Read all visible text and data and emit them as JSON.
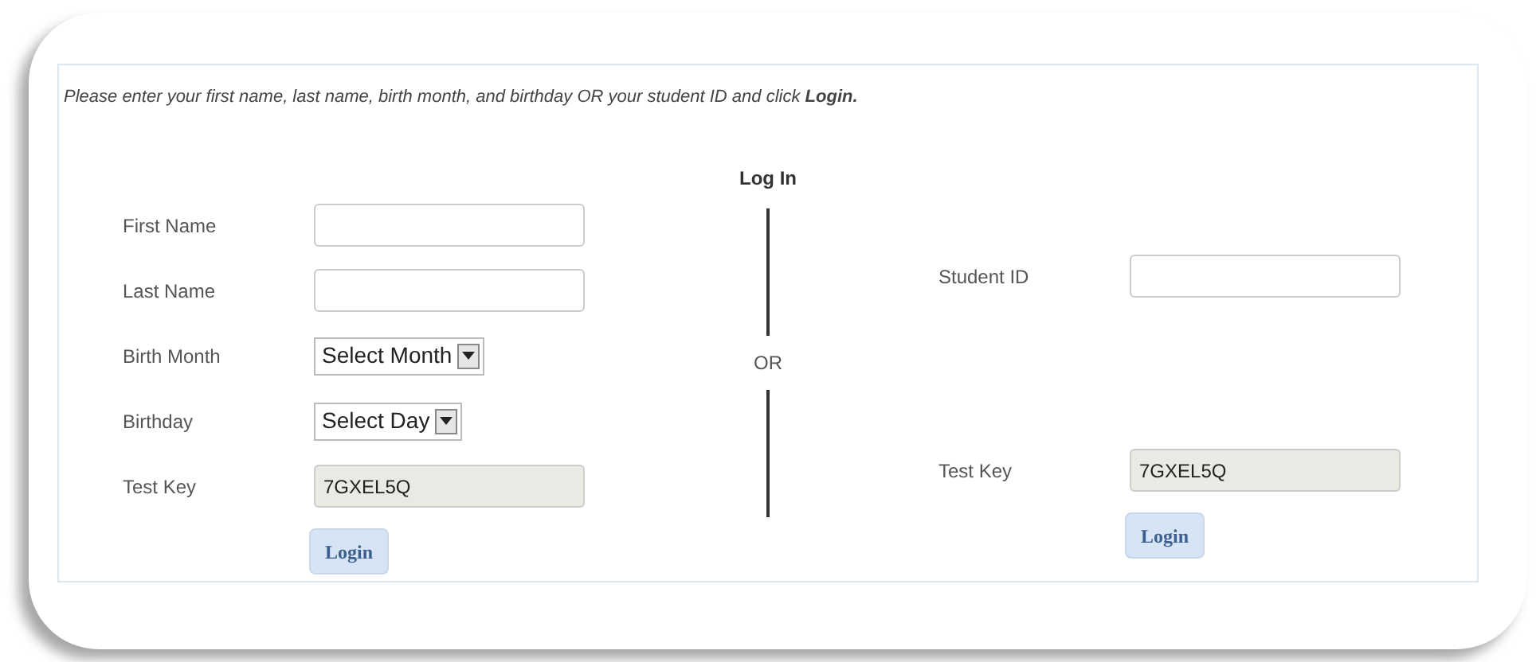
{
  "instructions": "Please enter your first name, last name, birth month, and birthday OR your student ID and click **Login.**",
  "heading": "Log In",
  "divider_text": "OR",
  "name_login": {
    "fields": [
      {
        "kind": "text",
        "label": "First Name"
      },
      {
        "kind": "text",
        "label": "Last Name"
      },
      {
        "kind": "select",
        "label": "Birth Month",
        "value": "Select Month"
      },
      {
        "kind": "select",
        "label": "Birthday",
        "value": "Select Day"
      },
      {
        "kind": "readonly",
        "label": "Test Key",
        "value": "7GXEL5Q"
      }
    ],
    "button": "Login"
  },
  "id_login": {
    "fields": [
      {
        "kind": "text",
        "label": "Student ID"
      },
      {
        "kind": "readonly",
        "label": "Test Key",
        "value": "7GXEL5Q"
      }
    ],
    "button": "Login"
  }
}
